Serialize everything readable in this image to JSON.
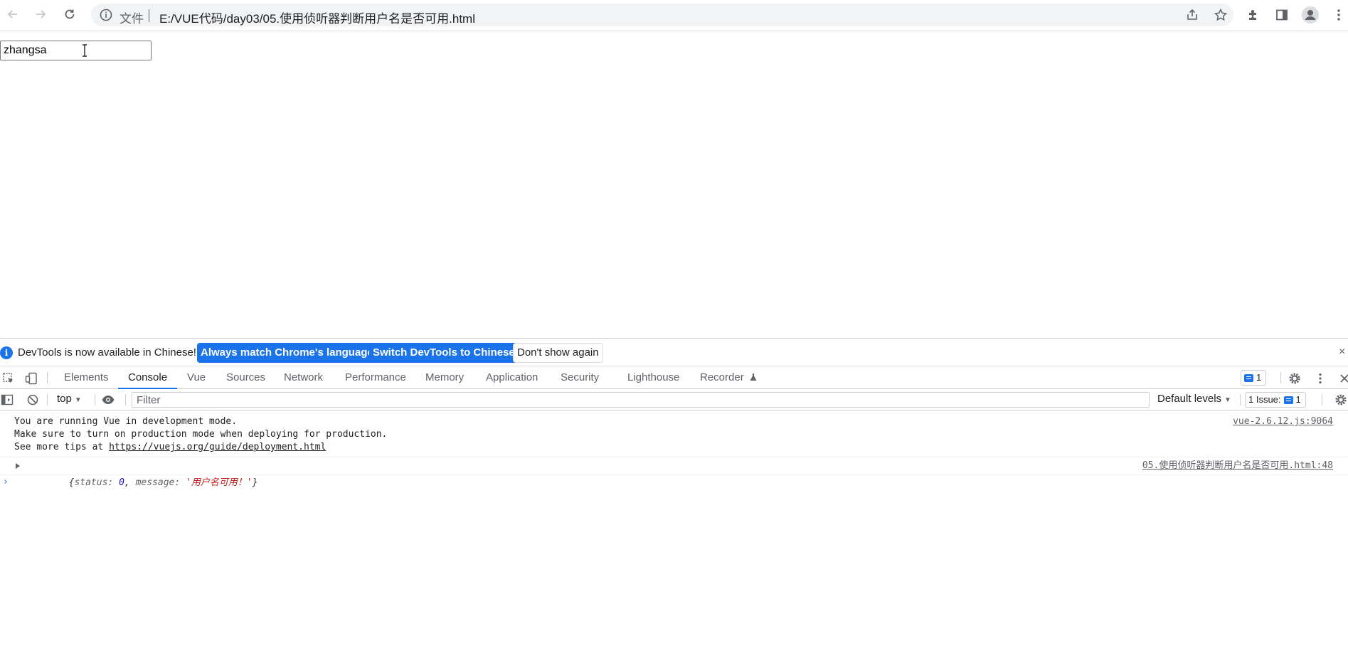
{
  "browser": {
    "omnibox": {
      "security_label": "文件",
      "url": "E:/VUE代码/day03/05.使用侦听器判断用户名是否可用.html"
    }
  },
  "page": {
    "username_value": "zhangsa"
  },
  "devtools": {
    "infobar": {
      "text": "DevTools is now available in Chinese!",
      "btn_match": "Always match Chrome's language",
      "btn_switch": "Switch DevTools to Chinese",
      "btn_dismiss": "Don't show again",
      "close": "×"
    },
    "tabs": {
      "elements": "Elements",
      "console": "Console",
      "vue": "Vue",
      "sources": "Sources",
      "network": "Network",
      "performance": "Performance",
      "memory": "Memory",
      "application": "Application",
      "security": "Security",
      "lighthouse": "Lighthouse",
      "recorder": "Recorder"
    },
    "issues_count": "1",
    "filterbar": {
      "context": "top",
      "filter_placeholder": "Filter",
      "levels": "Default levels",
      "issues_label": "1 Issue:",
      "issues_count": "1"
    },
    "console": {
      "message1": {
        "line1": "You are running Vue in development mode.",
        "line2": "Make sure to turn on production mode when deploying for production.",
        "line3_prefix": "See more tips at ",
        "line3_link": "https://vuejs.org/guide/deployment.html",
        "source": "vue-2.6.12.js:9064"
      },
      "message2": {
        "open": "{",
        "status_key": "status: ",
        "status_val": "0",
        "sep": ", ",
        "message_key": "message: ",
        "message_val": "'用户名可用！'",
        "close": "}",
        "source": "05.使用侦听器判断用户名是否可用.html:48"
      },
      "prompt": "›"
    }
  }
}
